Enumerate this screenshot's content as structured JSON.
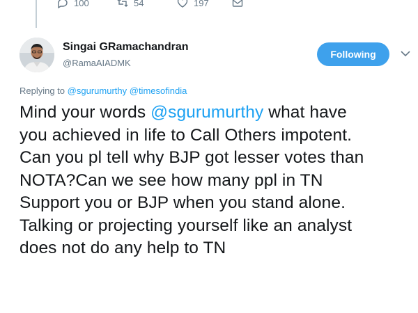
{
  "action_bar": {
    "reply_count": "100",
    "retweet_count": "54",
    "like_count": "197"
  },
  "tweet": {
    "author_name": "Singai GRamachandran",
    "author_handle": "@RamaAIADMK",
    "follow_button_label": "Following",
    "replying_prefix": "Replying to",
    "replying_mentions": [
      "@sgurumurthy",
      "@timesofindia"
    ],
    "text_lines": [
      {
        "before": "Mind your words ",
        "mention": "@sgurumurthy",
        "after": " what have"
      },
      {
        "before": "you achieved in life to Call Others impotent.",
        "mention": "",
        "after": ""
      },
      {
        "before": "Can you pl tell why BJP got lesser votes than",
        "mention": "",
        "after": ""
      },
      {
        "before": "NOTA?Can we see how many ppl in TN",
        "mention": "",
        "after": ""
      },
      {
        "before": "Support you or BJP when you stand alone.",
        "mention": "",
        "after": ""
      },
      {
        "before": "Talking or projecting yourself like an analyst",
        "mention": "",
        "after": ""
      },
      {
        "before": "does not do any help to TN",
        "mention": "",
        "after": ""
      }
    ]
  },
  "colors": {
    "accent": "#1da1f2",
    "follow_button": "#3ea1ec",
    "muted_text": "#657786",
    "primary_text": "#14171a"
  },
  "icons": {
    "reply": "reply-icon",
    "retweet": "retweet-icon",
    "like": "heart-icon",
    "dm": "envelope-icon",
    "caret": "chevron-down-icon"
  }
}
